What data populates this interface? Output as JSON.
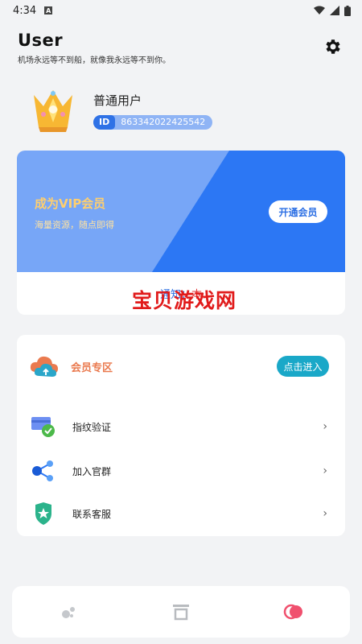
{
  "status_bar": {
    "time": "4:34",
    "notification_icon": "A"
  },
  "header": {
    "title": "User",
    "subtitle": "机场永远等不到船，就像我永远等不到你。"
  },
  "profile": {
    "username": "普通用户",
    "id_label": "ID",
    "id_value": "863342022425542"
  },
  "vip": {
    "title": "成为VIP会员",
    "description": "海量资源，随点即得",
    "button_label": "开通会员"
  },
  "notice": {
    "prefix": "通知：",
    "rest": "本"
  },
  "watermark": "宝贝游戏网",
  "members": {
    "label": "会员专区",
    "button_label": "点击进入"
  },
  "menu": [
    {
      "label": "指纹验证",
      "icon": "fingerprint-card-icon"
    },
    {
      "label": "加入官群",
      "icon": "share-icon"
    },
    {
      "label": "联系客服",
      "icon": "shield-star-icon"
    }
  ],
  "colors": {
    "primary_blue": "#2c77f4",
    "vip_gold": "#ffcf6e",
    "member_orange": "#ea7a4f",
    "enter_teal": "#1aa8c8",
    "watermark_red": "#e11b1b"
  }
}
